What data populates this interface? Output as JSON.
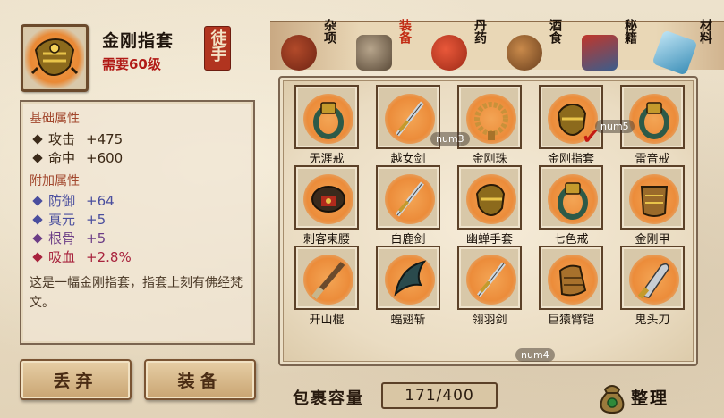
{
  "selected_item": {
    "name": "金刚指套",
    "requirement": "需要60级",
    "seal": "徒手",
    "icon": "gold-glove-icon"
  },
  "attributes": {
    "base_title": "基础属性",
    "base": [
      {
        "label": "攻击",
        "value": "+475",
        "color": "#3a2714"
      },
      {
        "label": "命中",
        "value": "+600",
        "color": "#3a2714"
      }
    ],
    "extra_title": "附加属性",
    "extra": [
      {
        "label": "防御",
        "value": "+64",
        "color": "#4a4e9e"
      },
      {
        "label": "真元",
        "value": "+5",
        "color": "#4a4e9e"
      },
      {
        "label": "根骨",
        "value": "+5",
        "color": "#6c3d86"
      },
      {
        "label": "吸血",
        "value": "+2.8%",
        "color": "#a8233d"
      }
    ],
    "description": "这是一幅金刚指套，指套上刻有佛经梵文。"
  },
  "buttons": {
    "discard": "丢弃",
    "equip": "装备"
  },
  "tabs": [
    {
      "label": "杂项",
      "icon": "jar-icon"
    },
    {
      "label": "装备",
      "icon": "scroll-icon"
    },
    {
      "label": "丹药",
      "icon": "pills-icon"
    },
    {
      "label": "酒食",
      "icon": "food-icon"
    },
    {
      "label": "秘籍",
      "icon": "book-icon"
    },
    {
      "label": "材料",
      "icon": "crystal-icon"
    }
  ],
  "inventory": [
    {
      "name": "无涯戒",
      "icon": "ring-icon"
    },
    {
      "name": "越女剑",
      "icon": "sword-icon"
    },
    {
      "name": "金刚珠",
      "icon": "beads-icon"
    },
    {
      "name": "金刚指套",
      "icon": "glove-icon",
      "equipped": true
    },
    {
      "name": "雷音戒",
      "icon": "ring-icon"
    },
    {
      "name": "刺客束腰",
      "icon": "belt-icon"
    },
    {
      "name": "白鹿剑",
      "icon": "sword-icon"
    },
    {
      "name": "幽蝉手套",
      "icon": "glove-icon"
    },
    {
      "name": "七色戒",
      "icon": "ring-icon"
    },
    {
      "name": "金刚甲",
      "icon": "armor-icon"
    },
    {
      "name": "开山棍",
      "icon": "staff-icon"
    },
    {
      "name": "蝠翅斩",
      "icon": "blade-icon"
    },
    {
      "name": "翎羽剑",
      "icon": "sword-icon"
    },
    {
      "name": "巨猿臂铠",
      "icon": "gauntlet-icon"
    },
    {
      "name": "鬼头刀",
      "icon": "saber-icon"
    }
  ],
  "hints": {
    "num3": "num3",
    "num5": "num5",
    "num4": "num4"
  },
  "capacity": {
    "label": "包裹容量",
    "value": "171/400"
  },
  "sort_button": "整理",
  "colors": {
    "accent_red": "#b11a16",
    "glow_orange": "#ec8c3a",
    "frame_brown": "#5c4128"
  }
}
